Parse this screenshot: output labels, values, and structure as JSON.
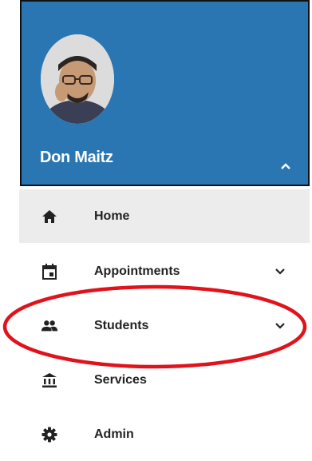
{
  "profile": {
    "name": "Don Maitz",
    "header_color": "#2a76b3"
  },
  "nav": {
    "items": [
      {
        "label": "Home",
        "icon": "home-icon",
        "active": true
      },
      {
        "label": "Appointments",
        "icon": "calendar-icon",
        "expandable": true
      },
      {
        "label": "Students",
        "icon": "people-icon",
        "expandable": true
      },
      {
        "label": "Services",
        "icon": "bank-icon"
      },
      {
        "label": "Admin",
        "icon": "gear-icon"
      }
    ]
  },
  "annotation": {
    "highlight_color": "#e0121b",
    "highlighted_item": "Students"
  }
}
